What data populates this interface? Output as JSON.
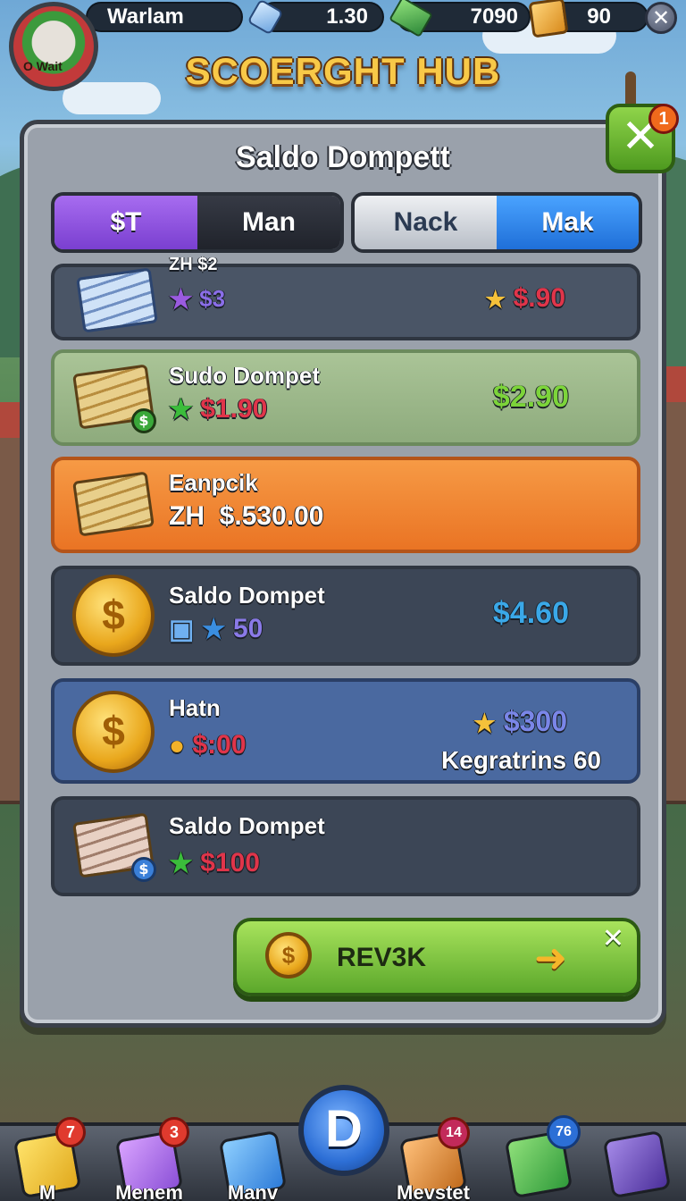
{
  "hud": {
    "player_name": "Warlam",
    "avatar_tag": "O Wait",
    "gems": "1.30",
    "cash": "7090",
    "crates": "90",
    "close_symbol": "✕"
  },
  "hub_title": "SCOERGHT HUB",
  "panel": {
    "title": "Saldo Dompett",
    "close_symbol": "✕",
    "close_badge": "1",
    "tabs_left": [
      "$T",
      "Man"
    ],
    "tabs_right": [
      "Nack",
      "Mak"
    ],
    "rows": [
      {
        "title": "ZH $2",
        "sub_value": "$3",
        "price": "$.90"
      },
      {
        "title": "Sudo Dompet",
        "sub_value": "$1.90",
        "price": "$2.90"
      },
      {
        "title": "Eanpcik",
        "sub_prefix": "ZH",
        "sub_value": "$.530.00"
      },
      {
        "title": "Saldo Dompet",
        "sub_value": "50",
        "price": "$4.60"
      },
      {
        "title": "Hatn",
        "sub_value": "$:00",
        "price": "$300",
        "extra": "Kegratrins 60"
      },
      {
        "title": "Saldo Dompet",
        "sub_value": "$100"
      }
    ],
    "cta_label": "REV3K",
    "cta_close": "✕"
  },
  "nav": {
    "items": [
      {
        "label": "M",
        "badge": "7"
      },
      {
        "label": "Menem",
        "badge": "3"
      },
      {
        "label": "Manv",
        "badge": ""
      },
      {
        "label": "Mevstet",
        "badge": "14"
      },
      {
        "label": "",
        "badge": "76"
      },
      {
        "label": "",
        "badge": ""
      }
    ],
    "center_label": "D"
  },
  "colors": {
    "accent_green": "#5ca82b",
    "accent_orange": "#f07f2c",
    "tab_purple": "#8a4fd6",
    "tab_blue": "#2c84ea",
    "price_green": "#7cd43a",
    "price_red": "#e0354a",
    "price_blue": "#3aa8e8"
  }
}
